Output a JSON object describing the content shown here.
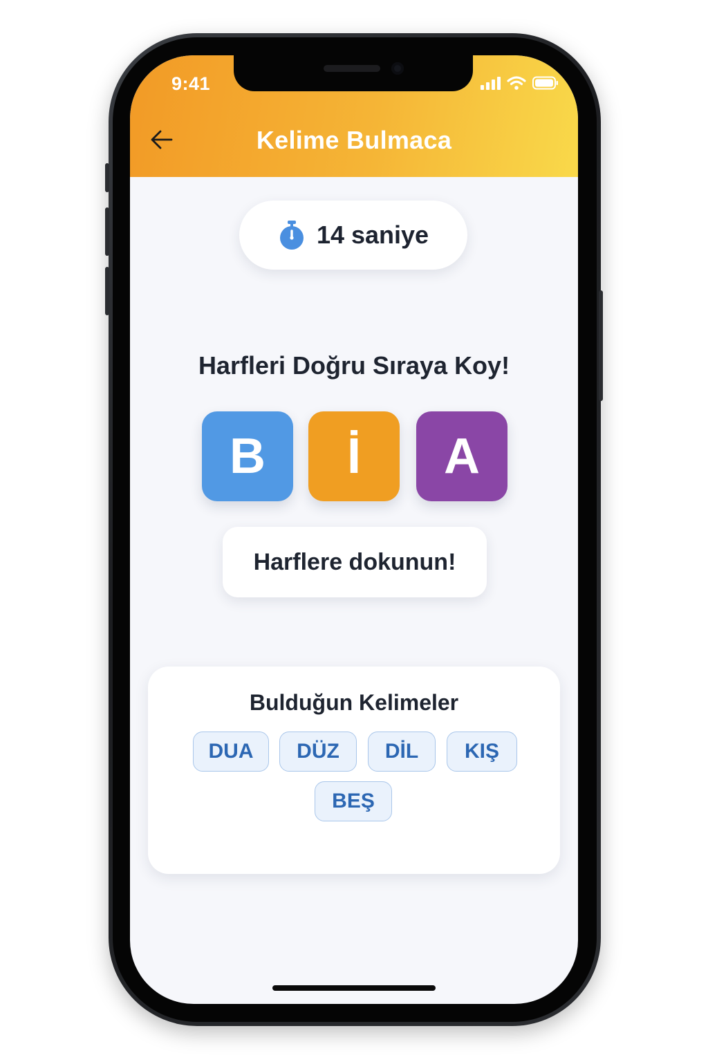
{
  "status_bar": {
    "time": "9:41",
    "icons": [
      "signal-icon",
      "wifi-icon",
      "battery-icon"
    ]
  },
  "header": {
    "back_icon": "arrow-left-icon",
    "title": "Kelime Bulmaca",
    "gradient": [
      "#f29a26",
      "#f9d94a"
    ]
  },
  "timer": {
    "icon": "stopwatch-icon",
    "text": "14 saniye",
    "icon_color": "#4a8fe0"
  },
  "instruction": "Harfleri Doğru Sıraya Koy!",
  "tiles": [
    {
      "letter": "B",
      "color": "#5199e4"
    },
    {
      "letter": "İ",
      "color": "#f09e22"
    },
    {
      "letter": "A",
      "color": "#8a46a6"
    }
  ],
  "hint": "Harflere dokunun!",
  "found_words": {
    "title": "Bulduğun Kelimeler",
    "words": [
      "DUA",
      "DÜZ",
      "DİL",
      "KIŞ",
      "BEŞ"
    ]
  }
}
